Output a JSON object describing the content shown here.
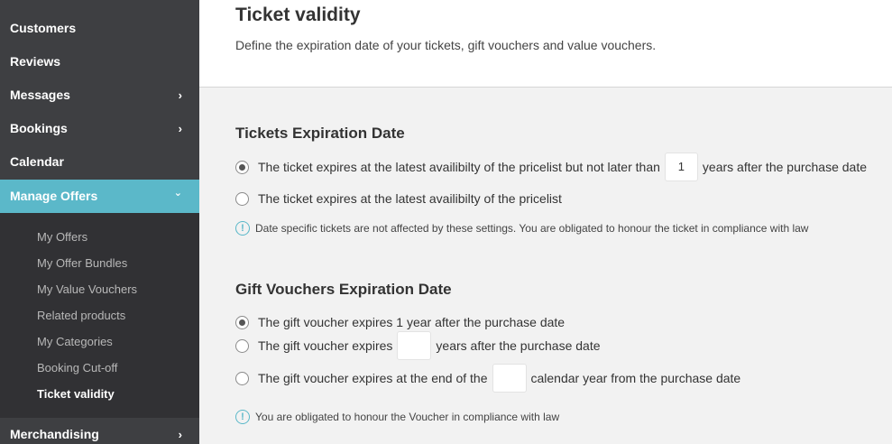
{
  "sidebar": {
    "items": [
      {
        "label": "Customers",
        "has_chevron": false
      },
      {
        "label": "Reviews",
        "has_chevron": false
      },
      {
        "label": "Messages",
        "has_chevron": true
      },
      {
        "label": "Bookings",
        "has_chevron": true
      },
      {
        "label": "Calendar",
        "has_chevron": false
      },
      {
        "label": "Manage Offers",
        "has_chevron": true,
        "expanded": true
      },
      {
        "label": "Merchandising",
        "has_chevron": true
      }
    ],
    "sub_items": [
      {
        "label": "My Offers"
      },
      {
        "label": "My Offer Bundles"
      },
      {
        "label": "My Value Vouchers"
      },
      {
        "label": "Related products"
      },
      {
        "label": "My Categories"
      },
      {
        "label": "Booking Cut-off"
      },
      {
        "label": "Ticket validity",
        "current": true
      }
    ],
    "chevron_right": "›",
    "chevron_down": "⌄"
  },
  "header": {
    "title": "Ticket validity",
    "subtitle": "Define the expiration date of your tickets, gift vouchers and value vouchers."
  },
  "tickets": {
    "title": "Tickets Expiration Date",
    "option1_before": "The ticket expires at the latest availibilty of the pricelist but not later than",
    "option1_value": "1",
    "option1_after": "years after the purchase date",
    "option2": "The ticket expires at the latest availibilty of the pricelist",
    "info": "Date specific tickets are not affected by these settings. You are obligated to honour the ticket in compliance with law",
    "selected": 1
  },
  "gift": {
    "title": "Gift Vouchers Expiration Date",
    "option1": "The gift voucher expires 1 year after the purchase date",
    "option2_before": "The gift voucher expires",
    "option2_value": "",
    "option2_after": "years after the purchase date",
    "option3_before": "The gift voucher expires at the end of the",
    "option3_value": "",
    "option3_after": "calendar year from the purchase date",
    "info": "You are obligated to honour the Voucher in compliance with law",
    "selected": 1
  },
  "colors": {
    "sidebar_bg": "#3e3f42",
    "subnav_bg": "#313134",
    "accent": "#5bb8c9"
  },
  "icons": {
    "info": "!"
  }
}
